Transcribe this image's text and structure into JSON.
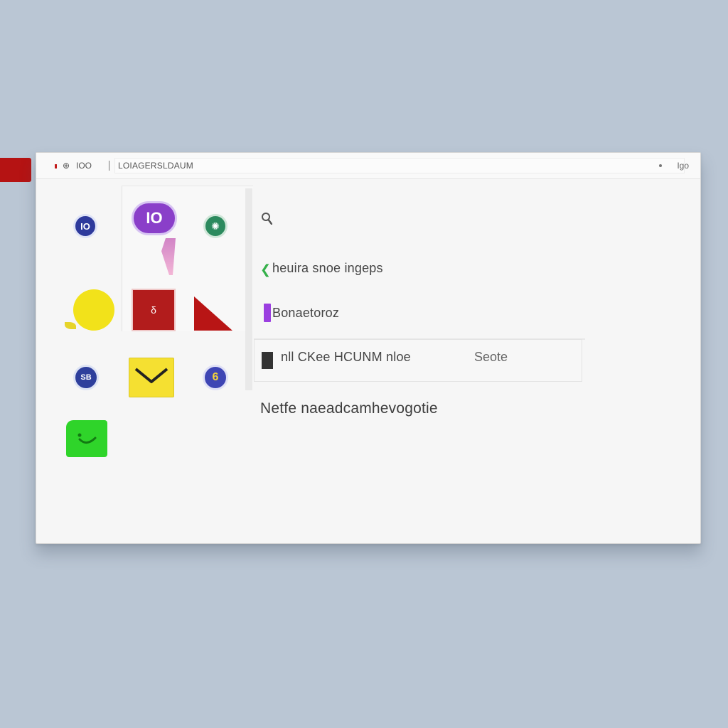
{
  "window": {
    "tab_glyph": "⊕",
    "title": "IOO",
    "address": "LOIAGERSLDAUM",
    "control_label": "Igo"
  },
  "apps": {
    "ia": {
      "label": "IO"
    },
    "chat": {
      "label": "IO"
    },
    "globe": {
      "label": "✺"
    },
    "book": {
      "label": "δ"
    },
    "sb": {
      "label": "SB"
    },
    "six": {
      "label": "6"
    }
  },
  "content": {
    "search_icon": "search-icon",
    "rows": [
      {
        "icon": "green-arrow-icon",
        "icon_glyph": "❮",
        "text": "heuira snoe ingeps"
      },
      {
        "icon": "purple-bar-icon",
        "text": "Bonaetoroz"
      },
      {
        "icon": "black-bar-icon",
        "text": "nll CKee HCUNM nloe",
        "side": "Seote"
      }
    ],
    "note": "Netfe naeadcamhevogotie"
  },
  "colors": {
    "desktop": "#bac6d4",
    "accent_red": "#b51313",
    "purple": "#8a3fc9",
    "yellow": "#f2e21a",
    "green": "#2fd42a",
    "navy": "#2e3a9c"
  }
}
